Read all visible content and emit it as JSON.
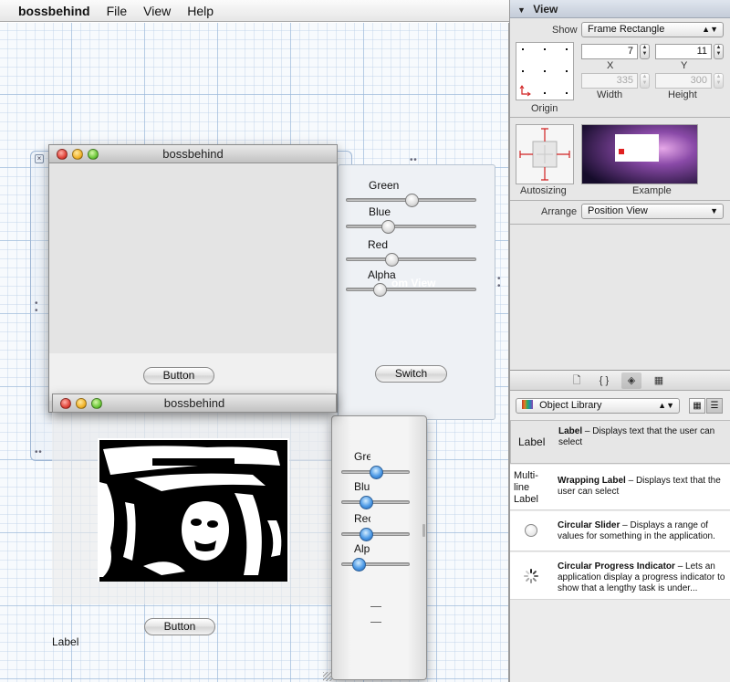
{
  "menubar": {
    "app": "bossbehind",
    "items": [
      "File",
      "View",
      "Help"
    ]
  },
  "canvas": {
    "overlay_text": "om View",
    "window1": {
      "title": "bossbehind",
      "button": "Button"
    },
    "window2": {
      "title": "bossbehind",
      "button": "Button",
      "label": "Label"
    },
    "custom_view": {
      "sliders": [
        {
          "label": "Green",
          "value": 0.5
        },
        {
          "label": "Blue",
          "value": 0.3
        },
        {
          "label": "Red",
          "value": 0.33
        },
        {
          "label": "Alpha",
          "value": 0.23
        }
      ],
      "button": "Switch"
    },
    "palette": {
      "sliders": [
        {
          "label": "Gre",
          "value": 0.5
        },
        {
          "label": "Blu",
          "value": 0.33
        },
        {
          "label": "Rec",
          "value": 0.33
        },
        {
          "label": "Alp",
          "value": 0.2
        }
      ]
    }
  },
  "inspector": {
    "title": "View",
    "show_label": "Show",
    "show_value": "Frame Rectangle",
    "x_value": "7",
    "y_value": "11",
    "x_label": "X",
    "y_label": "Y",
    "width_value": "335",
    "height_value": "300",
    "width_label": "Width",
    "height_label": "Height",
    "origin_label": "Origin",
    "autosizing_label": "Autosizing",
    "example_label": "Example",
    "arrange_label": "Arrange",
    "arrange_value": "Position View"
  },
  "library": {
    "popup": "Object Library",
    "items": [
      {
        "icon_text": "Label",
        "name": "Label",
        "desc": " – Displays text that the user can select"
      },
      {
        "icon_text": "Multi-line Label",
        "name": "Wrapping Label",
        "desc": " – Displays text that the user can select"
      },
      {
        "icon_text": "",
        "name": "Circular Slider",
        "desc": " – Displays a range of values for something in the application."
      },
      {
        "icon_text": "",
        "name": "Circular Progress Indicator",
        "desc": " – Lets an application display a progress indicator to show that a lengthy task is under..."
      }
    ]
  },
  "colors": {
    "canvas_grid": "#96b4d7",
    "selection_blue": "#9eb6d4",
    "knob_blue": "#4d9ae6"
  }
}
